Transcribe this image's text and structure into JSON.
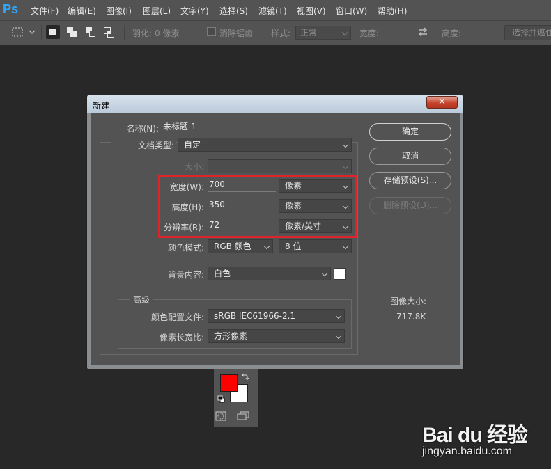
{
  "app": {
    "logo": "Ps"
  },
  "menu": [
    "文件(F)",
    "编辑(E)",
    "图像(I)",
    "图层(L)",
    "文字(Y)",
    "选择(S)",
    "滤镜(T)",
    "视图(V)",
    "窗口(W)",
    "帮助(H)"
  ],
  "options": {
    "feather_label": "羽化:",
    "feather_value": "0 像素",
    "antialias_label": "消除锯齿",
    "style_label": "样式:",
    "style_value": "正常",
    "width_label": "宽度:",
    "height_label": "高度:",
    "select_mask_label": "选择并遮住"
  },
  "dialog": {
    "title": "新建",
    "close_glyph": "✕",
    "name_label": "名称(N):",
    "name_value": "未标题-1",
    "doc_type_label": "文档类型:",
    "doc_type_value": "自定",
    "size_label": "大小:",
    "width_label": "宽度(W):",
    "width_value": "700",
    "width_unit": "像素",
    "height_label": "高度(H):",
    "height_value": "350",
    "height_unit": "像素",
    "resolution_label": "分辨率(R):",
    "resolution_value": "72",
    "resolution_unit": "像素/英寸",
    "color_mode_label": "颜色模式:",
    "color_mode_value": "RGB 颜色",
    "bit_depth_value": "8 位",
    "background_label": "背景内容:",
    "background_value": "白色",
    "advanced_label": "高级",
    "color_profile_label": "颜色配置文件:",
    "color_profile_value": "sRGB IEC61966-2.1",
    "pixel_aspect_label": "像素长宽比:",
    "pixel_aspect_value": "方形像素",
    "buttons": {
      "ok": "确定",
      "cancel": "取消",
      "save_preset": "存储预设(S)...",
      "delete_preset": "删除预设(D)..."
    },
    "image_size_label": "图像大小:",
    "image_size_value": "717.8K"
  },
  "colors": {
    "foreground": "#ff0000",
    "background": "#ffffff",
    "highlight_box": "#e0222c",
    "accent": "#31a8ff"
  },
  "watermark": {
    "logo": "Bai du 经验",
    "url": "jingyan.baidu.com"
  }
}
